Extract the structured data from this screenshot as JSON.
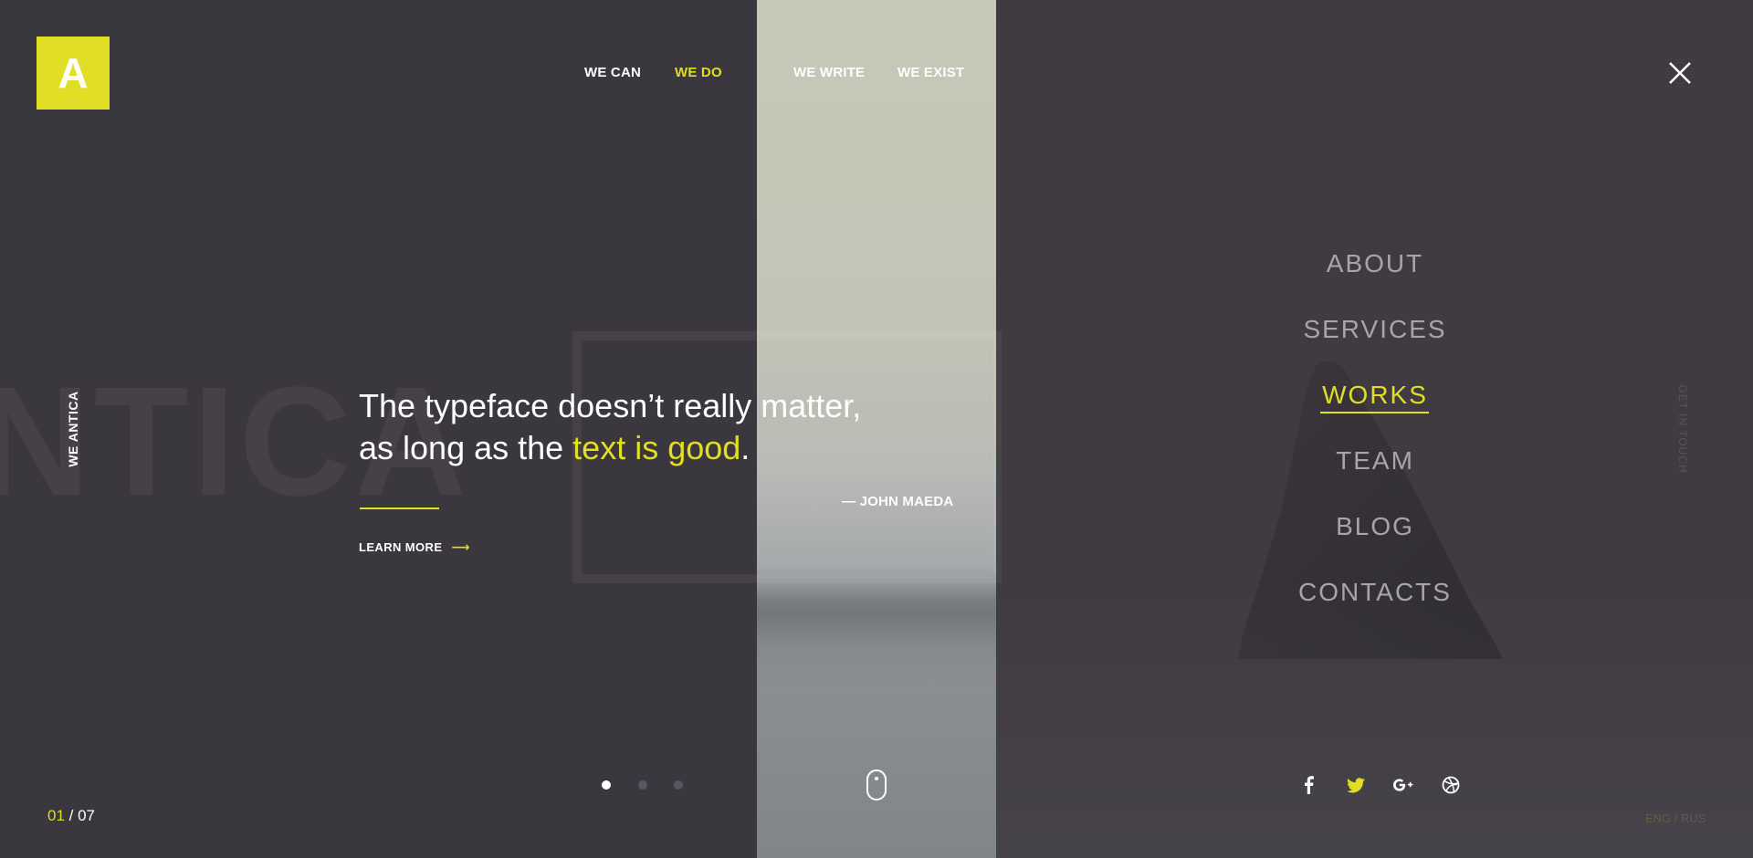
{
  "logo": {
    "letter": "A"
  },
  "top_nav": [
    {
      "label": "WE CAN",
      "active": false
    },
    {
      "label": "WE DO",
      "active": true
    },
    {
      "label": "WE WRITE",
      "active": false
    },
    {
      "label": "WE EXIST",
      "active": false
    }
  ],
  "background_word": "NTICA",
  "vertical_label": "WE ANTICA",
  "quote": {
    "line1": "The typeface doesn’t really matter,",
    "line2_prefix": "as long as the ",
    "line2_highlight": "text is good",
    "line2_suffix": ".",
    "author": "— JOHN MAEDA"
  },
  "learn_more": {
    "label": "LEARN MORE",
    "arrow": "⟶"
  },
  "slider": {
    "dots": 3,
    "active_index": 0
  },
  "counter": {
    "current": "01",
    "separator": " / ",
    "total": "07"
  },
  "menu": [
    {
      "label": "ABOUT",
      "active": false
    },
    {
      "label": "SERVICES",
      "active": false
    },
    {
      "label": "WORKS",
      "active": true
    },
    {
      "label": "TEAM",
      "active": false
    },
    {
      "label": "BLOG",
      "active": false
    },
    {
      "label": "CONTACTS",
      "active": false
    }
  ],
  "get_in_touch": "GET IN TOUCH",
  "social": [
    "facebook-icon",
    "twitter-icon",
    "google-plus-icon",
    "dribbble-icon"
  ],
  "languages": {
    "selected": "ENG",
    "separator": " / ",
    "other": "RUS"
  },
  "colors": {
    "accent": "#e2dd25",
    "background": "#3b373e",
    "menu_inactive": "#a7a4ab"
  }
}
